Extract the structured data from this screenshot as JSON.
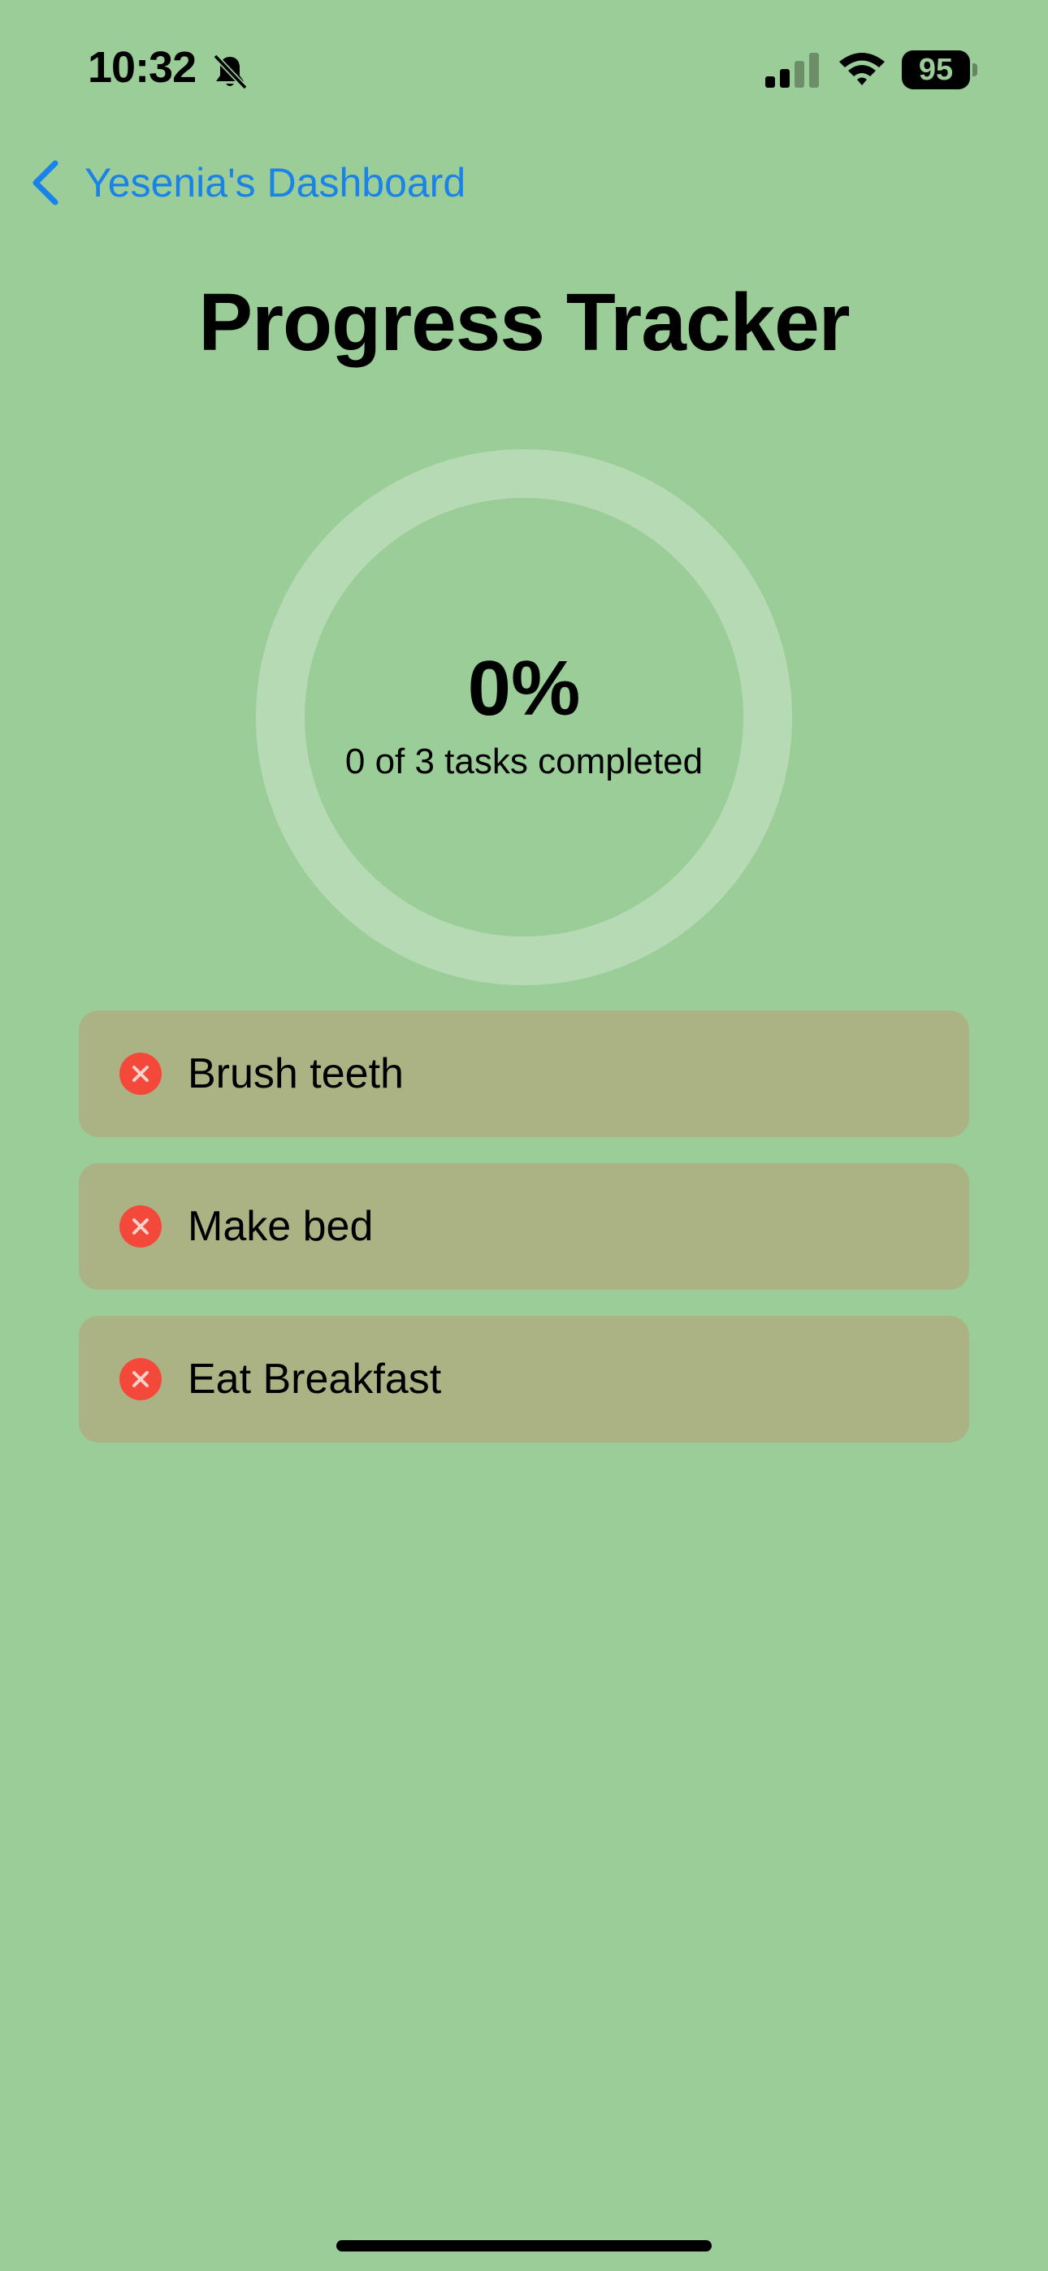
{
  "status_bar": {
    "time": "10:32",
    "battery_level": "95",
    "icons": [
      "bell-slash-icon",
      "signal-icon",
      "wifi-icon",
      "battery-icon"
    ]
  },
  "nav": {
    "back_label": "Yesenia's Dashboard",
    "back_icon": "chevron-left-icon"
  },
  "title": "Progress Tracker",
  "progress": {
    "percent_label": "0%",
    "fraction": 0,
    "caption": "0 of 3 tasks completed"
  },
  "tasks": [
    {
      "label": "Brush teeth",
      "status_icon": "x-circle-icon"
    },
    {
      "label": "Make bed",
      "status_icon": "x-circle-icon"
    },
    {
      "label": "Eat Breakfast",
      "status_icon": "x-circle-icon"
    }
  ],
  "colors": {
    "background": "#9bcd99",
    "link": "#1a82e8",
    "task_background": "#abb385",
    "ring_track": "#b6dbb4",
    "incomplete_icon": "#f4483a"
  }
}
